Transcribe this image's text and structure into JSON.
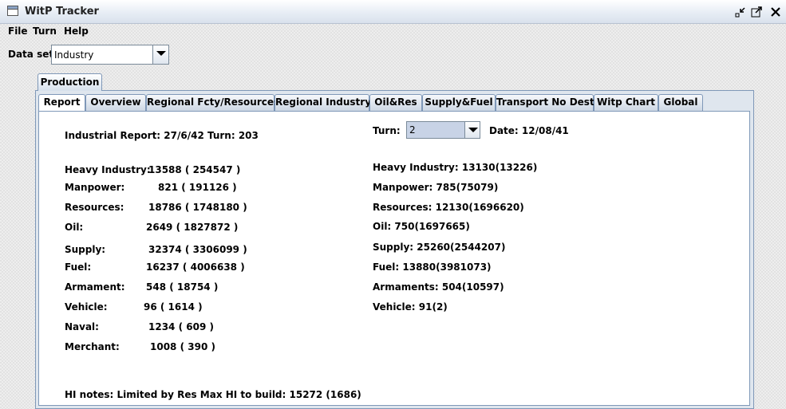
{
  "window": {
    "title": "WitP Tracker"
  },
  "menu": {
    "file": "File",
    "turn": "Turn",
    "help": "Help"
  },
  "dataset": {
    "label": "Data set:",
    "value": "Industry"
  },
  "outer_tab": {
    "label": "Production"
  },
  "tabs": [
    "Report",
    "Overview",
    "Regional Fcty/Resources",
    "Regional Industry",
    "Oil&Res",
    "Supply&Fuel",
    "Transport No Dest",
    "Witp Chart",
    "Global"
  ],
  "report": {
    "header": "Industrial Report: 27/6/42  Turn: 203",
    "rows": [
      {
        "label": "Heavy Industry:",
        "value": "13588 ( 254547 )"
      },
      {
        "label": "Manpower:",
        "value": "821 ( 191126 )"
      },
      {
        "label": "Resources:",
        "value": "18786 ( 1748180 )"
      },
      {
        "label": "Oil:",
        "value": "2649 ( 1827872 )"
      },
      {
        "label": "Supply:",
        "value": "32374 ( 3306099 )"
      },
      {
        "label": "Fuel:",
        "value": "16237 ( 4006638 )"
      },
      {
        "label": "Armament:",
        "value": "548 ( 18754 )"
      },
      {
        "label": "Vehicle:",
        "value": "96 ( 1614 )"
      },
      {
        "label": "Naval:",
        "value": "1234 ( 609 )"
      },
      {
        "label": "Merchant:",
        "value": "1008 ( 390 )"
      }
    ],
    "notes": "HI notes: Limited by Res  Max HI to build: 15272  (1686)"
  },
  "compare": {
    "turn_label": "Turn:",
    "turn_value": "2",
    "date": "Date: 12/08/41",
    "rows": [
      "Heavy Industry: 13130(13226)",
      "Manpower: 785(75079)",
      "Resources: 12130(1696620)",
      "Oil: 750(1697665)",
      "Supply: 25260(2544207)",
      "Fuel: 13880(3981073)",
      "Armaments: 504(10597)",
      "Vehicle: 91(2)"
    ]
  }
}
